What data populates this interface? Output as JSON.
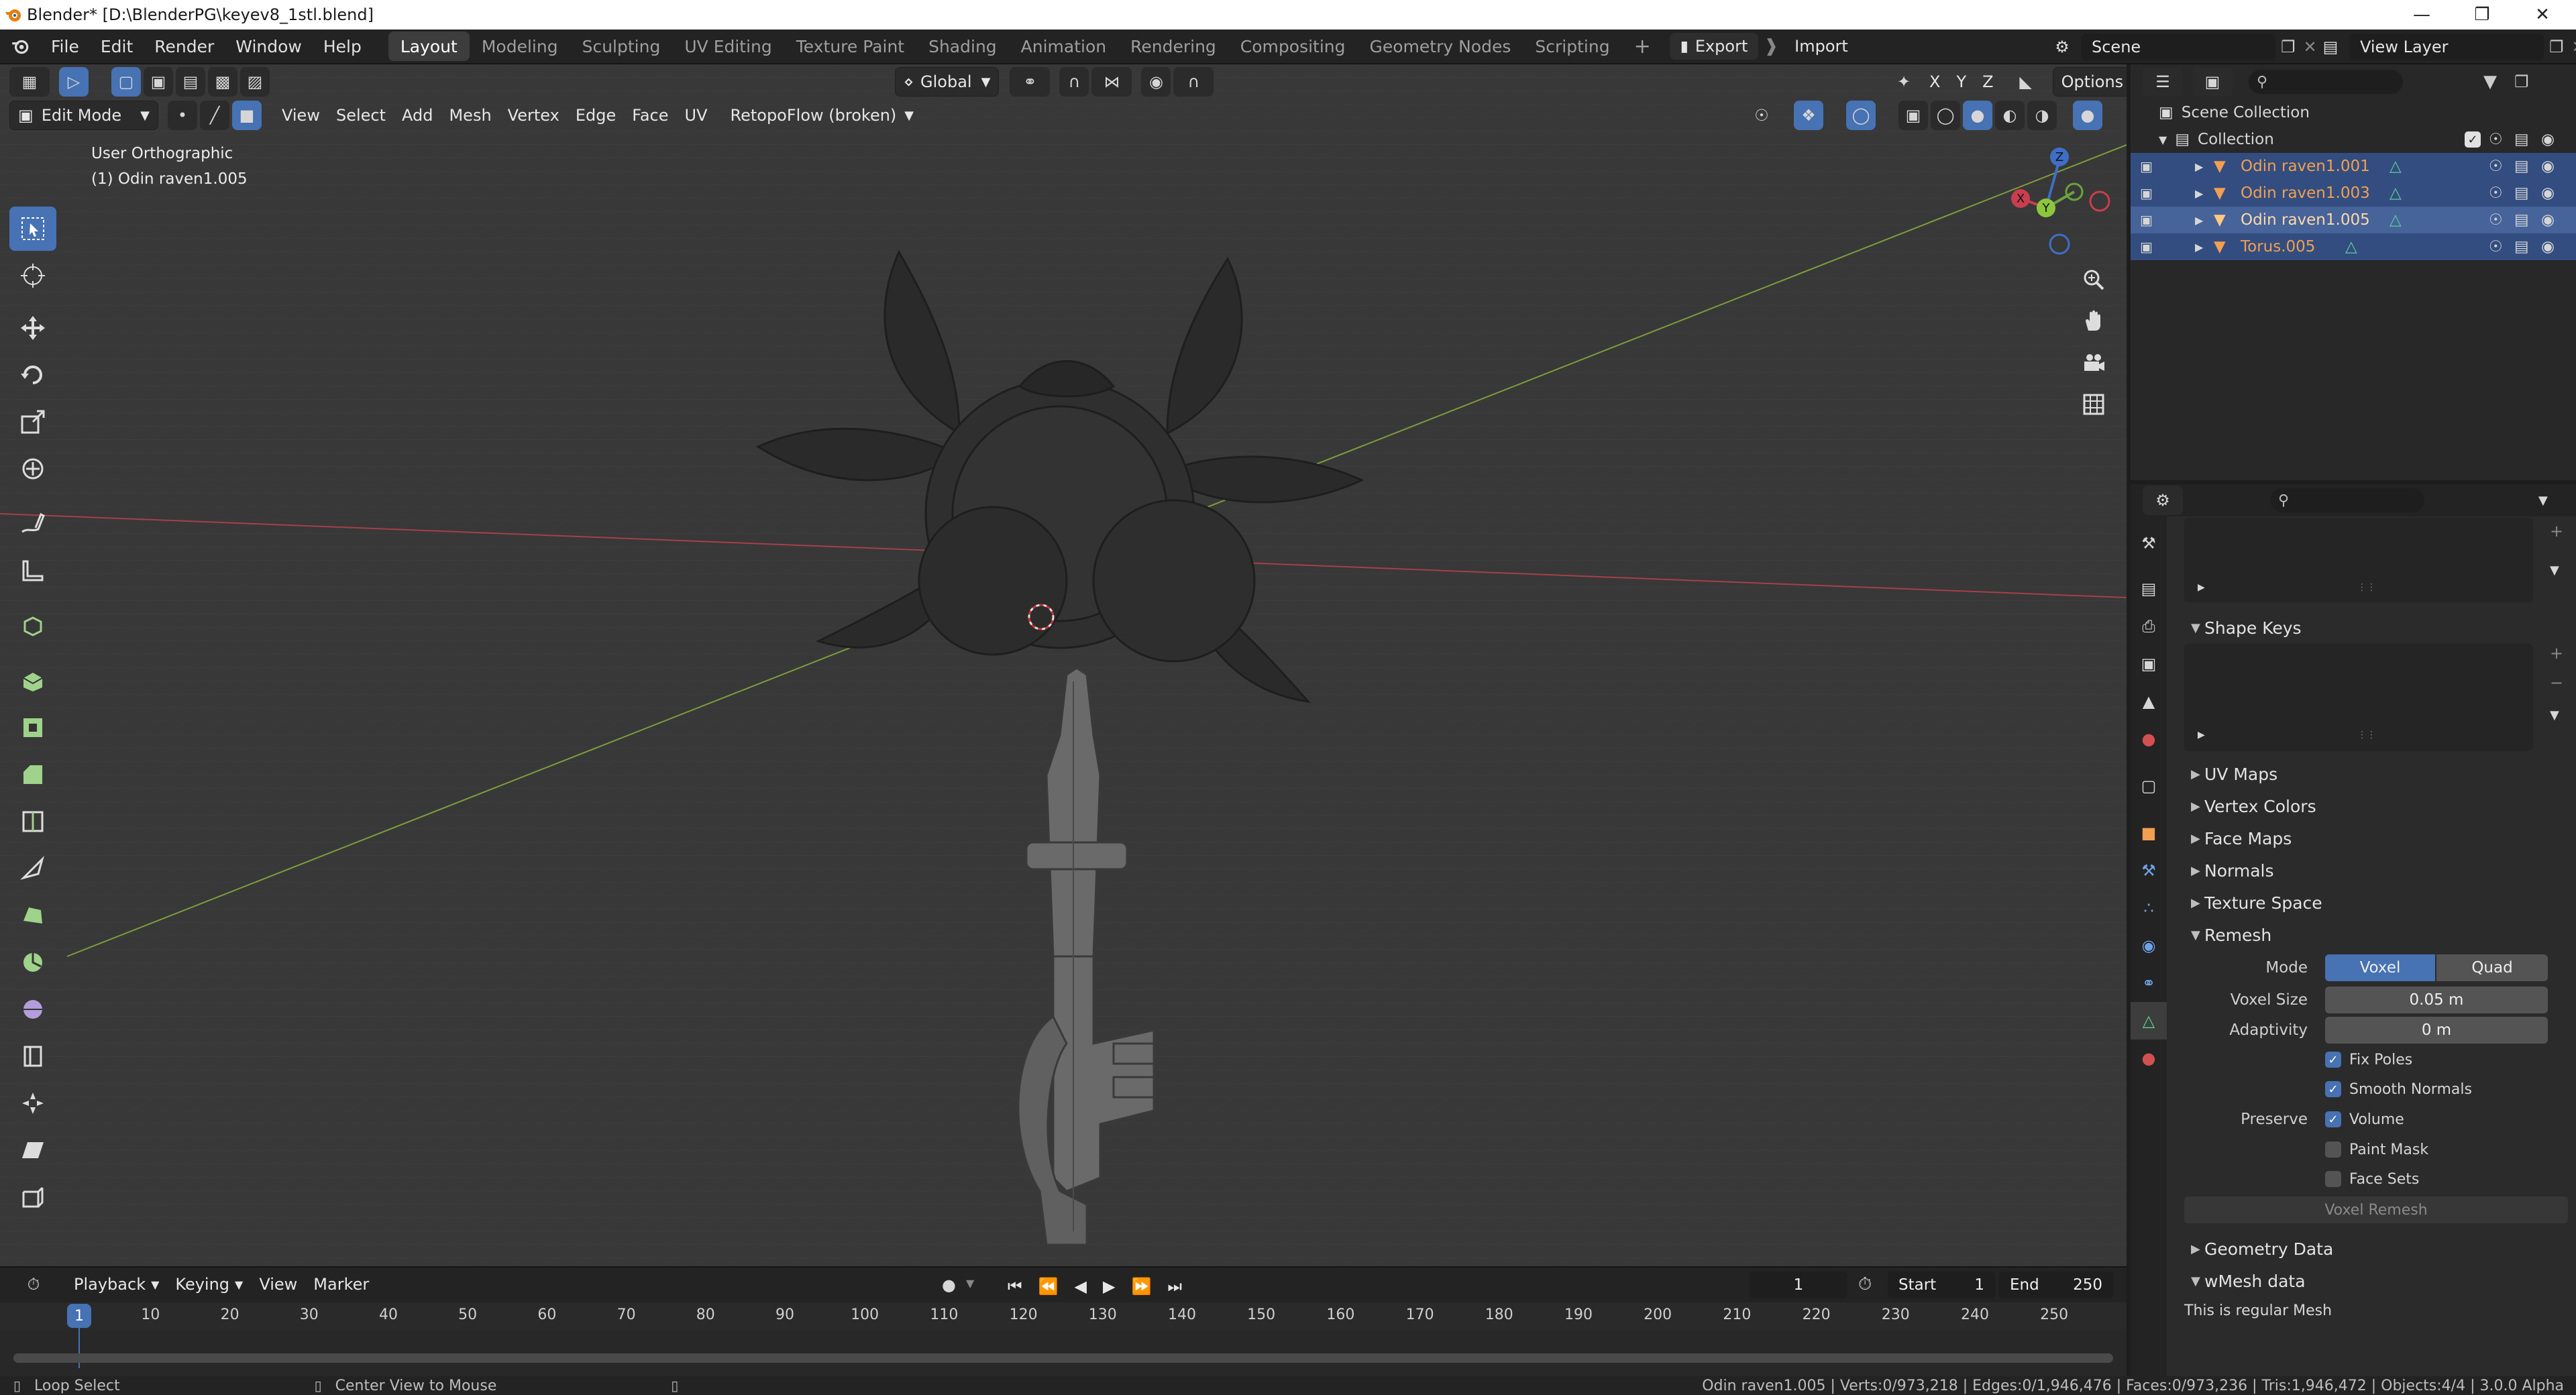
{
  "window": {
    "title": "Blender* [D:\\BlenderPG\\keyev8_1stl.blend]"
  },
  "menus": [
    "File",
    "Edit",
    "Render",
    "Window",
    "Help"
  ],
  "workspaces": [
    "Layout",
    "Modeling",
    "Sculpting",
    "UV Editing",
    "Texture Paint",
    "Shading",
    "Animation",
    "Rendering",
    "Compositing",
    "Geometry Nodes",
    "Scripting"
  ],
  "active_workspace": "Layout",
  "topbar": {
    "export_label": "Export",
    "import_label": "Import",
    "scene": "Scene",
    "view_layer": "View Layer"
  },
  "viewport": {
    "transform_orientation": "Global",
    "options_label": "Options",
    "mode": "Edit Mode",
    "header_menus": [
      "View",
      "Select",
      "Add",
      "Mesh",
      "Vertex",
      "Edge",
      "Face",
      "UV"
    ],
    "addon_menu": "RetopoFlow (broken)",
    "view_name": "User Orthographic",
    "object_name": "(1) Odin raven1.005",
    "axis_x": "X",
    "axis_y": "Y",
    "axis_z": "Z"
  },
  "outliner": {
    "scene_collection": "Scene Collection",
    "collection": "Collection",
    "objects": [
      {
        "name": "Odin raven1.001",
        "selected": true
      },
      {
        "name": "Odin raven1.003",
        "selected": true
      },
      {
        "name": "Odin raven1.005",
        "selected": true,
        "active": true
      },
      {
        "name": "Torus.005",
        "selected": true
      }
    ]
  },
  "properties": {
    "shape_keys": "Shape Keys",
    "collapsed_panels": [
      "UV Maps",
      "Vertex Colors",
      "Face Maps",
      "Normals",
      "Texture Space"
    ],
    "remesh": {
      "title": "Remesh",
      "mode_label": "Mode",
      "mode_voxel": "Voxel",
      "mode_quad": "Quad",
      "voxel_size_label": "Voxel Size",
      "voxel_size": "0.05 m",
      "adaptivity_label": "Adaptivity",
      "adaptivity": "0 m",
      "fix_poles": "Fix Poles",
      "smooth_normals": "Smooth Normals",
      "preserve_label": "Preserve",
      "volume": "Volume",
      "paint_mask": "Paint Mask",
      "face_sets": "Face Sets",
      "button": "Voxel Remesh"
    },
    "geometry_data": "Geometry Data",
    "wmesh_data": "wMesh data",
    "wmesh_note": "This is regular Mesh"
  },
  "timeline": {
    "menus": [
      "Playback",
      "Keying",
      "View",
      "Marker"
    ],
    "current_frame": "1",
    "start_label": "Start",
    "start": "1",
    "end_label": "End",
    "end": "250",
    "ticks": [
      "1",
      "10",
      "20",
      "30",
      "40",
      "50",
      "60",
      "70",
      "80",
      "90",
      "100",
      "110",
      "120",
      "130",
      "140",
      "150",
      "160",
      "170",
      "180",
      "190",
      "200",
      "210",
      "220",
      "230",
      "240",
      "250"
    ]
  },
  "statusbar": {
    "loop_select": "Loop Select",
    "center_view": "Center View to Mouse",
    "stats": "Odin raven1.005 | Verts:0/973,218 | Edges:0/1,946,476 | Faces:0/973,236 | Tris:1,946,472 | Objects:4/4 | 3.0.0 Alpha"
  },
  "colors": {
    "accent": "#4772b3",
    "object_orange": "#f0a050",
    "selected_row": "#334d80"
  }
}
